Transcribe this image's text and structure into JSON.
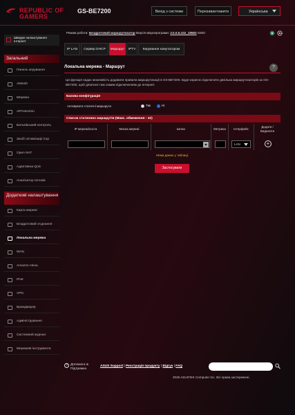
{
  "header": {
    "brand_line1": "REPUBLIC OF",
    "brand_line2": "GAMERS",
    "model": "GS-BE7200",
    "logout_label": "Вихід з системи",
    "reboot_label": "Перезавантажити",
    "language": "Українська"
  },
  "status": {
    "mode_label": "Режим роботи:",
    "mode_value": "Бездротовий маршрутизатор",
    "fw_label": "Версія мікропрограми:",
    "fw_value": "3.0.0.6.102_18583",
    "ssid_label": "SSID:"
  },
  "sidebar": {
    "quick_setup": "Швидке налаштування Інтернет",
    "general_title": "Загальний",
    "general_items": [
      {
        "label": "Панель керування",
        "icon": "dashboard-icon"
      },
      {
        "label": "AiMesh",
        "icon": "aimesh-icon"
      },
      {
        "label": "Мережа",
        "icon": "network-icon"
      },
      {
        "label": "AiProtection",
        "icon": "aiprotection-icon"
      },
      {
        "label": "Батьківський контроль",
        "icon": "parental-icon"
      },
      {
        "label": "Засіб оптимізації ігор",
        "icon": "game-optimizer-icon"
      },
      {
        "label": "Open NAT",
        "icon": "open-nat-icon"
      },
      {
        "label": "Адаптивна QoS",
        "icon": "qos-icon"
      },
      {
        "label": "Аналізатор потоків",
        "icon": "traffic-analyzer-icon"
      }
    ],
    "advanced_title": "Додаткові налаштування",
    "advanced_items": [
      {
        "label": "Карта мережі",
        "icon": "network-map-icon",
        "active": false
      },
      {
        "label": "Бездротовий з'єднання",
        "icon": "wireless-icon",
        "active": false
      },
      {
        "label": "Локальна мережа",
        "icon": "lan-icon",
        "active": true
      },
      {
        "label": "WAN",
        "icon": "wan-icon",
        "active": false
      },
      {
        "label": "Amazon Alexa",
        "icon": "alexa-icon",
        "active": false
      },
      {
        "label": "IPv6",
        "icon": "ipv6-icon",
        "active": false
      },
      {
        "label": "VPN",
        "icon": "vpn-icon",
        "active": false
      },
      {
        "label": "Брандмауер",
        "icon": "firewall-icon",
        "active": false
      },
      {
        "label": "Адміністрування",
        "icon": "admin-icon",
        "active": false
      },
      {
        "label": "Системний журнал",
        "icon": "syslog-icon",
        "active": false
      },
      {
        "label": "Мережеві інструменти",
        "icon": "network-tools-icon",
        "active": false
      }
    ]
  },
  "tabs": [
    {
      "label": "IP LAN",
      "active": false
    },
    {
      "label": "Сервер DHCP",
      "active": false
    },
    {
      "label": "Маршрут",
      "active": true
    },
    {
      "label": "IPTV",
      "active": false
    },
    {
      "label": "Керування комутатором",
      "active": false
    }
  ],
  "main": {
    "title": "Локальна мережа - Маршрут",
    "description": "Ця функція надає можливість додавати правила маршрутизації в GS-BE7200. Буде корисно підключити декілька маршрутизаторів за GS-BE7200, щоб ділитися тим самим підключенням до Інтернет.",
    "basic_config_title": "Базова конфігурація",
    "static_routes_label": "Активувати статичні маршрути",
    "radio_yes": "Так",
    "radio_no": "Ні",
    "radio_selected": "Ні",
    "list_title": "Список статичних маршрутів (Макс. обмеження : 32)",
    "columns": [
      "IP мережі/хоста",
      "Маска мережі",
      "Шлюз",
      "Метрика",
      "Інтерфейс",
      "Додати / Видалити"
    ],
    "interface_value": "LAN",
    "empty_message": "Нема даних у таблиці.",
    "apply_label": "Застосувати"
  },
  "footer": {
    "help_label": "Допомога & Підтримка",
    "links": [
      "ASUS Support",
      "Реєстрація продукту",
      "Відгук",
      "FAQ"
    ],
    "copyright": "2026 ASUSTeK Computer Inc. Всі права застережені."
  },
  "colors": {
    "accent": "#c8102e",
    "bar": "#7a0a14",
    "empty_text": "#e8b630"
  }
}
